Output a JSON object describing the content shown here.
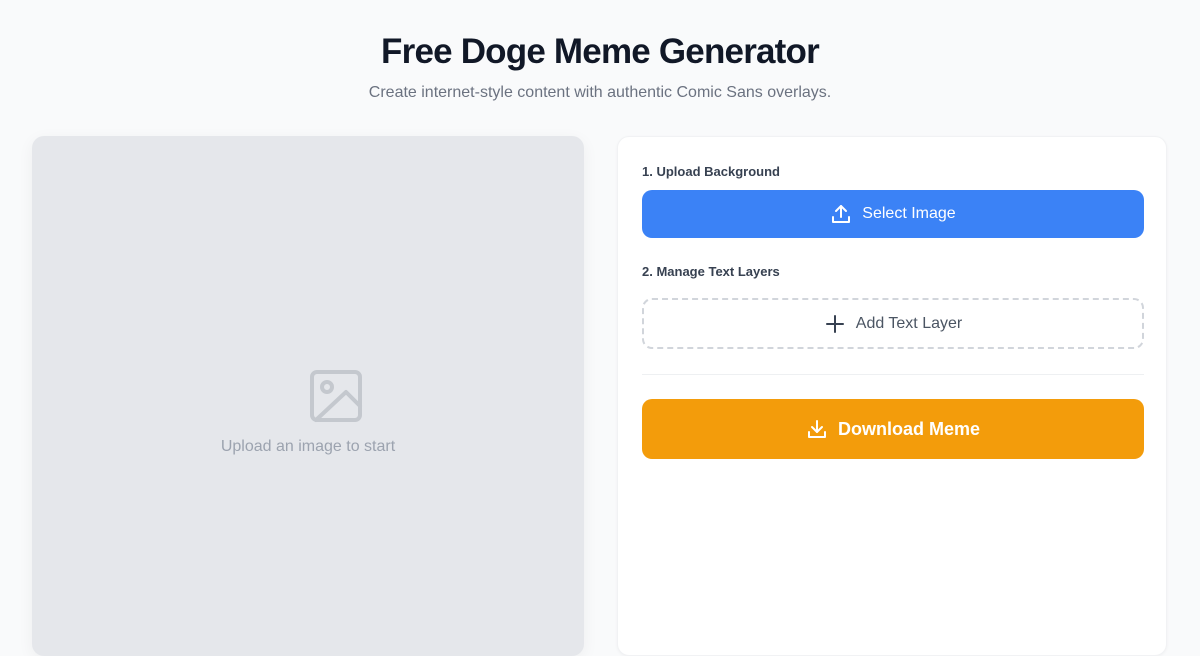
{
  "header": {
    "title": "Free Doge Meme Generator",
    "subtitle": "Create internet-style content with authentic Comic Sans overlays."
  },
  "canvas": {
    "placeholder_icon": "image-icon",
    "placeholder_text": "Upload an image to start"
  },
  "controls": {
    "upload_label": "1. Upload Background",
    "select_image_label": "Select Image",
    "select_image_icon": "upload-icon",
    "layers_label": "2. Manage Text Layers",
    "add_text_layer_label": "Add Text Layer",
    "add_text_layer_icon": "plus-icon",
    "download_label": "Download Meme",
    "download_icon": "download-icon"
  },
  "colors": {
    "primary": "#3b82f6",
    "download": "#f39c0b",
    "canvas_bg": "#e5e7eb"
  }
}
